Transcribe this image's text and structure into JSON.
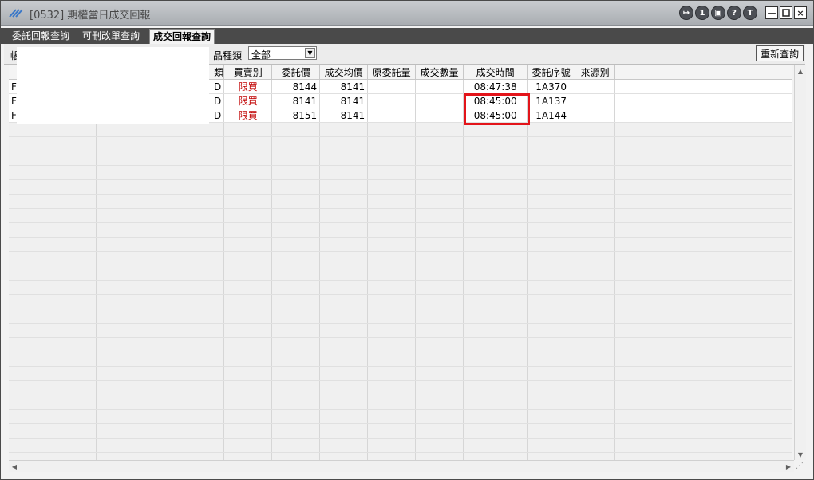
{
  "window": {
    "title": "[0532] 期權當日成交回報"
  },
  "titlebar_buttons": {
    "circle2": "1",
    "circle4": "?",
    "circle5": "T",
    "minimize": "—",
    "close": "×"
  },
  "tabs": [
    {
      "label": "委託回報查詢"
    },
    {
      "label": "可刪改單查詢"
    },
    {
      "label": "成交回報查詢"
    }
  ],
  "toolbar": {
    "left_label": "帳",
    "product_label": "品種類",
    "product_select": "全部",
    "refresh_button": "重新查詢"
  },
  "table": {
    "headers": [
      "",
      "",
      "類",
      "買賣別",
      "委託價",
      "成交均價",
      "原委託量",
      "成交數量",
      "成交時間",
      "委託序號",
      "來源別"
    ],
    "rows": [
      {
        "c0": "F",
        "c2": "D",
        "side": "限買",
        "order_price": "8144",
        "avg_price": "8141",
        "time": "08:47:38",
        "order_no": "1A370"
      },
      {
        "c0": "F",
        "c2": "D",
        "side": "限買",
        "order_price": "8141",
        "avg_price": "8141",
        "time": "08:45:00",
        "order_no": "1A137"
      },
      {
        "c0": "F",
        "c2": "D",
        "side": "限買",
        "order_price": "8151",
        "avg_price": "8141",
        "time": "08:45:00",
        "order_no": "1A144"
      }
    ]
  },
  "colors": {
    "highlight": "#e3141a",
    "sell_buy_text": "#c00000",
    "tab_strip": "#4a4a4a"
  },
  "icons": [
    "app-logo-icon",
    "exit-icon",
    "info-icon",
    "print-icon",
    "help-icon",
    "t-icon",
    "minimize-icon",
    "maximize-icon",
    "close-icon",
    "dropdown-arrow-icon"
  ]
}
